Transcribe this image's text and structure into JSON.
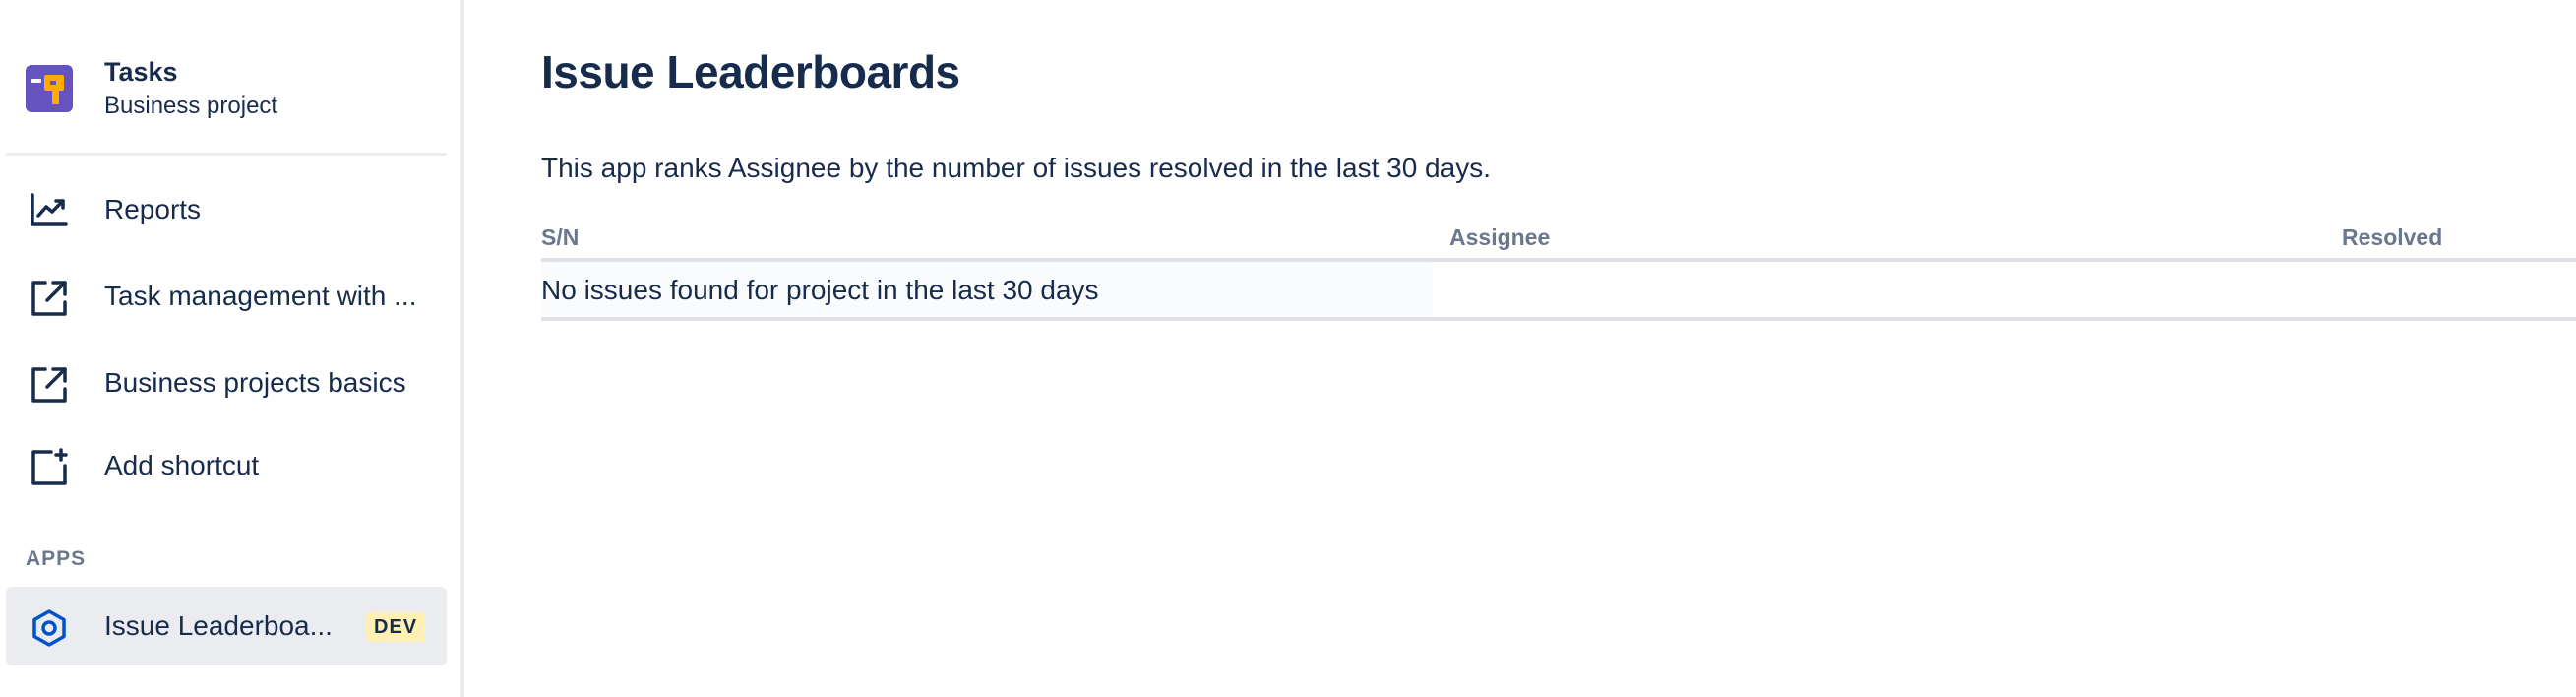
{
  "sidebar": {
    "project": {
      "name": "Tasks",
      "type": "Business project"
    },
    "items": [
      {
        "label": "Reports",
        "icon": "chart-line-icon"
      },
      {
        "label": "Task management with ...",
        "icon": "external-link-icon"
      },
      {
        "label": "Business projects basics",
        "icon": "external-link-icon"
      },
      {
        "label": "Add shortcut",
        "icon": "add-shortcut-icon"
      }
    ],
    "apps_heading": "APPS",
    "apps": [
      {
        "label": "Issue Leaderboa...",
        "badge": "DEV",
        "icon": "hexagon-app-icon",
        "selected": true
      }
    ]
  },
  "main": {
    "title": "Issue Leaderboards",
    "description": "This app ranks Assignee by the number of issues resolved in the last 30 days.",
    "table": {
      "columns": [
        "S/N",
        "Assignee",
        "Resolved"
      ],
      "empty_message": "No issues found for project in the last 30 days"
    }
  },
  "colors": {
    "text": "#172b4d",
    "muted": "#6b778c",
    "project_avatar": "#6554c0",
    "app_icon": "#0052cc",
    "dev_badge_bg": "#fff0b3",
    "selected_bg": "#ebecf0"
  }
}
